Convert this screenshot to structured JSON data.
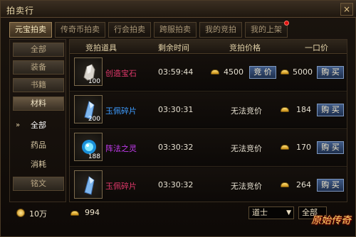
{
  "window": {
    "title": "拍卖行",
    "close_label": "×"
  },
  "tabs": [
    {
      "label": "元宝拍卖",
      "active": true
    },
    {
      "label": "传奇币拍卖",
      "active": false
    },
    {
      "label": "行会拍卖",
      "active": false
    },
    {
      "label": "跨服拍卖",
      "active": false
    },
    {
      "label": "我的竞拍",
      "active": false
    },
    {
      "label": "我的上架",
      "active": false,
      "badge": true
    }
  ],
  "sidebar": {
    "categories": [
      "全部",
      "装备",
      "书籍",
      "材料",
      "铭文"
    ],
    "sub_items": [
      {
        "label": "全部",
        "active": true
      },
      {
        "label": "药品",
        "active": false
      },
      {
        "label": "消耗",
        "active": false
      }
    ],
    "active_marker": "»"
  },
  "table": {
    "headers": [
      "竞拍道具",
      "剩余时间",
      "竞拍价格",
      "一口价"
    ],
    "rows": [
      {
        "icon": "stone-icon",
        "qty": "100",
        "name": "创造宝石",
        "name_color": "#e0386a",
        "time": "03:59:44",
        "bid": "4500",
        "bid_button": "竞 价",
        "buyout": "5000",
        "buy_button": "购 买"
      },
      {
        "icon": "crystal-shard-icon",
        "qty": "200",
        "name": "玉佩碎片",
        "name_color": "#3d9cff",
        "time": "03:30:31",
        "bid_text": "无法竞价",
        "buyout": "184",
        "buy_button": "购 买"
      },
      {
        "icon": "spirit-orb-icon",
        "qty": "188",
        "name": "阵法之灵",
        "name_color": "#c43cf0",
        "time": "03:30:32",
        "bid_text": "无法竞价",
        "buyout": "170",
        "buy_button": "购 买"
      },
      {
        "icon": "crystal-shard-icon",
        "qty": "",
        "name": "玉佩碎片",
        "name_color": "#e0386a",
        "time": "03:30:32",
        "bid_text": "无法竞价",
        "buyout": "264",
        "buy_button": "购 买"
      }
    ]
  },
  "footer": {
    "coins": "10万",
    "ingots": "994",
    "class_filter": "道士",
    "second_filter": "全部"
  },
  "logo_text": "原始传奇"
}
